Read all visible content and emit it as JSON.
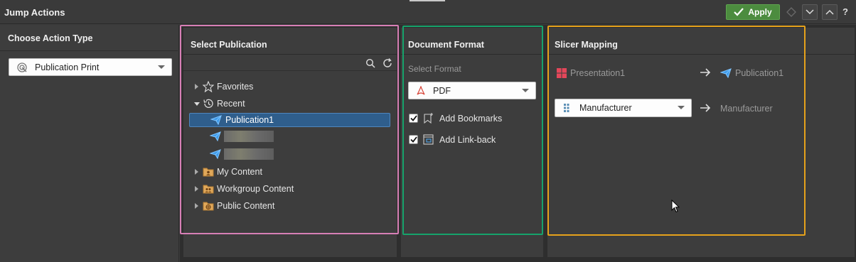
{
  "window": {
    "title": "Jump Actions"
  },
  "toolbar": {
    "apply_label": "Apply",
    "help_label": "?"
  },
  "action_type": {
    "header": "Choose Action Type",
    "selected": "Publication Print"
  },
  "select_publication": {
    "header": "Select Publication",
    "tree": {
      "favorites": "Favorites",
      "recent": "Recent",
      "recent_items": [
        "Publication1"
      ],
      "my_content": "My Content",
      "workgroup_content": "Workgroup Content",
      "public_content": "Public Content"
    }
  },
  "document_format": {
    "header": "Document Format",
    "select_label": "Select Format",
    "format": "PDF",
    "options": [
      {
        "label": "Add Bookmarks",
        "checked": true
      },
      {
        "label": "Add Link-back",
        "checked": true
      }
    ]
  },
  "slicer_mapping": {
    "header": "Slicer Mapping",
    "source": "Presentation1",
    "target": "Publication1",
    "mapping_from": "Manufacturer",
    "mapping_to": "Manufacturer"
  },
  "colors": {
    "outline_publication": "#d77fb6",
    "outline_format": "#16a36b",
    "outline_slicer": "#e6a21b",
    "accent_blue": "#3d9ae8",
    "apply_green": "#4c8c3f"
  }
}
